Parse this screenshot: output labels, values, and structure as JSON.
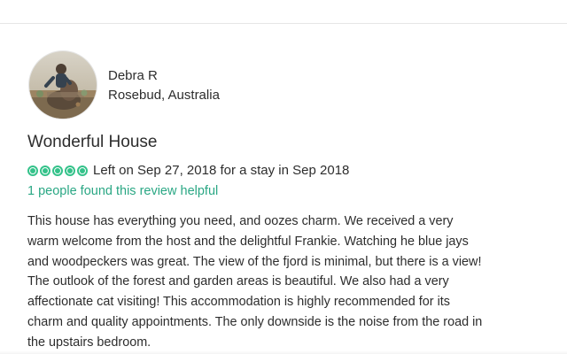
{
  "reviewer": {
    "name": "Debra R",
    "location": "Rosebud, Australia",
    "avatar_icon": "avatar"
  },
  "review": {
    "title": "Wonderful House",
    "rating": {
      "value": 5,
      "max": 5,
      "color": "#34c28a",
      "icon": "rating-bubble-icon"
    },
    "date_line": "Left on Sep 27, 2018 for a stay in Sep 2018",
    "helpful_text": "1 people found this review helpful",
    "body_lines": [
      "This house has everything you need, and oozes charm. We received a very",
      "warm welcome from the host and the delightful Frankie. Watching he blue jays",
      "and woodpeckers was great. The view of the fjord is minimal, but there is a view!",
      "The outlook of the forest and garden areas is beautiful. We also had a very",
      "affectionate cat visiting! This accommodation is highly recommended for its",
      "charm and quality appointments. The only downside is the noise from the road in",
      "the upstairs bedroom."
    ]
  },
  "colors": {
    "accent": "#2aa784",
    "text": "#2d2d2d",
    "divider": "#e6e6e6"
  }
}
